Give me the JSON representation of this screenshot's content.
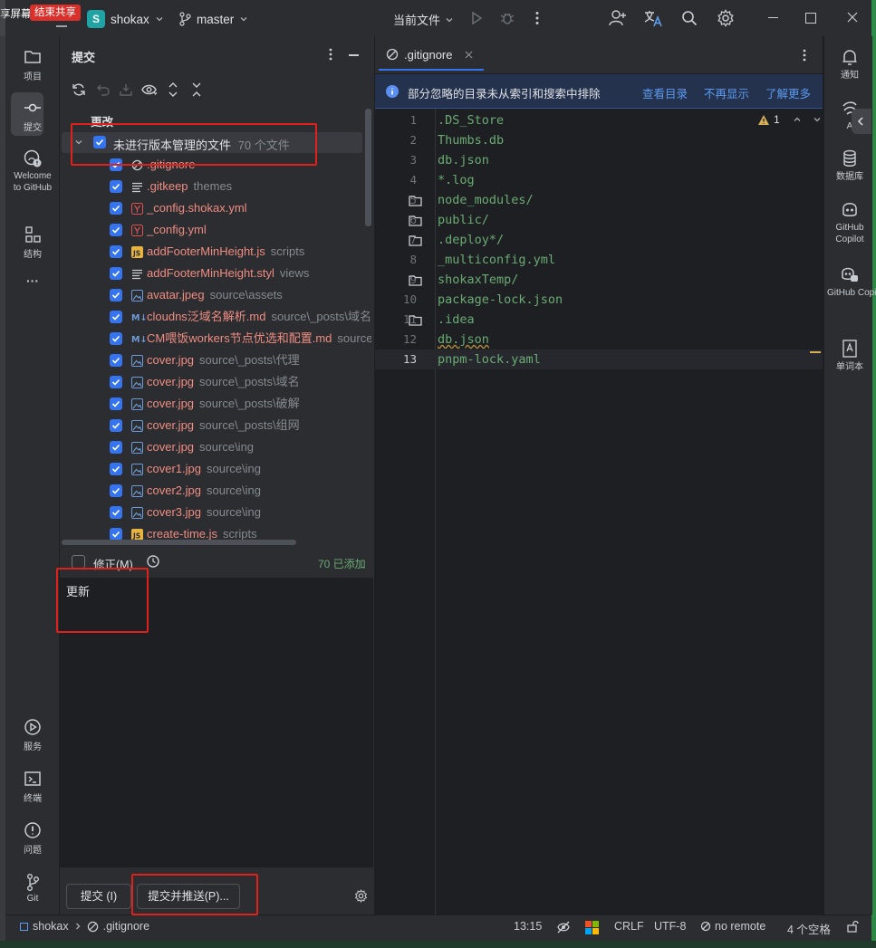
{
  "title_bar": {
    "screen_share_label": "享屏幕",
    "end_share_label": "结束共享",
    "project_badge": "S",
    "project_name": "shokax",
    "branch_name": "master",
    "run_config": "当前文件"
  },
  "left_tool_window": {
    "items": [
      {
        "label": "项目",
        "icon": "folder-icon"
      },
      {
        "label": "提交",
        "icon": "commit-icon"
      },
      {
        "label": "Welcome to GitHub",
        "icon": "github-icon"
      },
      {
        "label": "结构",
        "icon": "structure-icon"
      },
      {
        "label": "服务",
        "icon": "services-icon"
      },
      {
        "label": "终端",
        "icon": "terminal-icon"
      },
      {
        "label": "问题",
        "icon": "problems-icon"
      },
      {
        "label": "Git",
        "icon": "git-icon"
      }
    ],
    "welcome_line1": "Welcome",
    "welcome_line2": "to GitHub",
    "more_label": "···"
  },
  "commit_panel": {
    "title": "提交",
    "changes_label": "更改",
    "group_label": "未进行版本管理的文件",
    "group_count": "70 个文件",
    "files": [
      {
        "name": ".gitignore",
        "path": "",
        "icon": "ignore-icon"
      },
      {
        "name": ".gitkeep",
        "path": "themes",
        "icon": "text-icon"
      },
      {
        "name": "_config.shokax.yml",
        "path": "",
        "icon": "yaml-icon"
      },
      {
        "name": "_config.yml",
        "path": "",
        "icon": "yaml-icon"
      },
      {
        "name": "addFooterMinHeight.js",
        "path": "scripts",
        "icon": "js-icon"
      },
      {
        "name": "addFooterMinHeight.styl",
        "path": "views",
        "icon": "text-icon"
      },
      {
        "name": "avatar.jpeg",
        "path": "source\\assets",
        "icon": "image-icon"
      },
      {
        "name": "cloudns泛域名解析.md",
        "path": "source\\_posts\\域名",
        "icon": "markdown-icon"
      },
      {
        "name": "CM喂饭workers节点优选和配置.md",
        "path": "source\\",
        "icon": "markdown-icon"
      },
      {
        "name": "cover.jpg",
        "path": "source\\_posts\\代理",
        "icon": "image-icon"
      },
      {
        "name": "cover.jpg",
        "path": "source\\_posts\\域名",
        "icon": "image-icon"
      },
      {
        "name": "cover.jpg",
        "path": "source\\_posts\\破解",
        "icon": "image-icon"
      },
      {
        "name": "cover.jpg",
        "path": "source\\_posts\\组网",
        "icon": "image-icon"
      },
      {
        "name": "cover.jpg",
        "path": "source\\ing",
        "icon": "image-icon"
      },
      {
        "name": "cover1.jpg",
        "path": "source\\ing",
        "icon": "image-icon"
      },
      {
        "name": "cover2.jpg",
        "path": "source\\ing",
        "icon": "image-icon"
      },
      {
        "name": "cover3.jpg",
        "path": "source\\ing",
        "icon": "image-icon"
      },
      {
        "name": "create-time.js",
        "path": "scripts",
        "icon": "js-icon"
      }
    ],
    "amend_label": "修正(M)",
    "added_status": "70 已添加",
    "commit_message": "更新",
    "commit_button": "提交 (I)",
    "commit_push_button": "提交并推送(P)..."
  },
  "editor": {
    "tab_name": ".gitignore",
    "banner_text": "部分忽略的目录未从索引和搜索中排除",
    "banner_link_view": "查看目录",
    "banner_link_dismiss": "不再显示",
    "banner_link_more": "了解更多",
    "warning_count": "1",
    "lines": [
      {
        "num": "1",
        "text": ".DS_Store",
        "folder": false
      },
      {
        "num": "2",
        "text": "Thumbs.db",
        "folder": false
      },
      {
        "num": "3",
        "text": "db.json",
        "folder": false
      },
      {
        "num": "4",
        "text": "*.log",
        "folder": false
      },
      {
        "num": "5",
        "text": "node_modules/",
        "folder": true
      },
      {
        "num": "6",
        "text": "public/",
        "folder": true
      },
      {
        "num": "7",
        "text": ".deploy*/",
        "folder": true
      },
      {
        "num": "8",
        "text": "_multiconfig.yml",
        "folder": false
      },
      {
        "num": "9",
        "text": "shokaxTemp/",
        "folder": true
      },
      {
        "num": "10",
        "text": "package-lock.json",
        "folder": false
      },
      {
        "num": "11",
        "text": ".idea",
        "folder": true
      },
      {
        "num": "12",
        "text": "db.json",
        "folder": false
      },
      {
        "num": "13",
        "text": "pnpm-lock.yaml",
        "folder": false
      }
    ]
  },
  "right_tool_window": {
    "items": [
      {
        "label": "通知",
        "icon": "bell-icon"
      },
      {
        "label": "A",
        "icon": "ai-icon"
      },
      {
        "label": "数据库",
        "icon": "database-icon"
      },
      {
        "label": "GitHub Copilot",
        "icon": "copilot-icon"
      },
      {
        "label": "GitHub Copilot C",
        "icon": "copilot-chat-icon"
      },
      {
        "label": "单词本",
        "icon": "wordbook-icon"
      }
    ]
  },
  "status_bar": {
    "project": "shokax",
    "file": ".gitignore",
    "position": "13:15",
    "line_ending": "CRLF",
    "encoding": "UTF-8",
    "vcs": "no remote",
    "indent": "4 个空格"
  },
  "colors": {
    "background": "#1e1f22",
    "panel": "#2b2d30",
    "accent": "#3574f0",
    "untracked_file": "#f08c82",
    "code_string": "#6aab73",
    "highlight_box": "#e0201a"
  }
}
